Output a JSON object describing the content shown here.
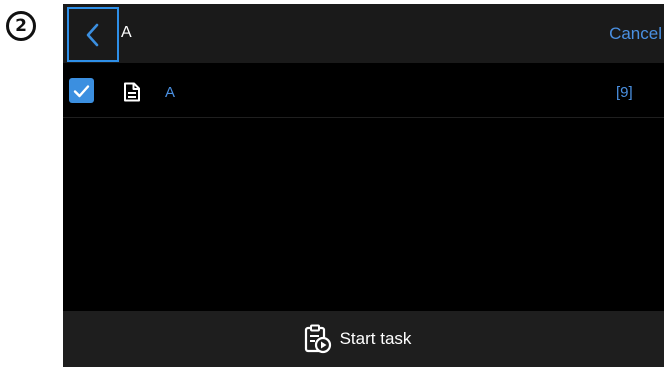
{
  "annotation": {
    "step_number": "2"
  },
  "header": {
    "title": "A",
    "cancel_label": "Cancel",
    "back_icon": "chevron-left-icon"
  },
  "list": {
    "items": [
      {
        "label": "A",
        "count": "[9]",
        "checked": true,
        "icon": "document-icon"
      }
    ]
  },
  "footer": {
    "start_label": "Start task",
    "icon": "clipboard-play-icon"
  },
  "colors": {
    "accent": "#3b8fe0",
    "link": "#4a90e2",
    "topbar_bg": "#1a1a1a",
    "footer_bg": "#1e1e1e",
    "content_bg": "#000000"
  }
}
